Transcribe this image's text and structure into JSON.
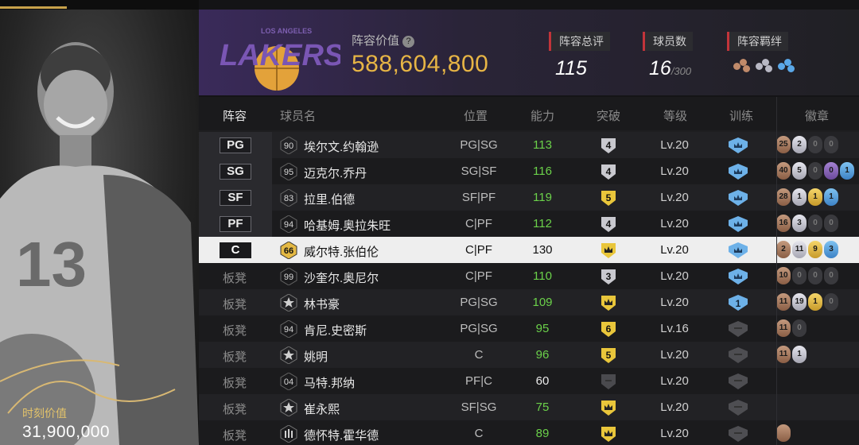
{
  "portrait": {
    "value_label": "时刻价值",
    "value": "31,900,000",
    "jersey_number": "13"
  },
  "header": {
    "team_logo_text": "LAKERS",
    "team_logo_arc": "LOS ANGELES",
    "lineup_value_label": "阵容价值",
    "lineup_value_help": "?",
    "lineup_value": "588,604,800",
    "overall_label": "阵容总评",
    "overall_value": "115",
    "players_label": "球员数",
    "players_value": "16",
    "players_max": "/300",
    "bonds_label": "阵容羁绊"
  },
  "columns": {
    "lineup": "阵容",
    "name": "球员名",
    "position": "位置",
    "ability": "能力",
    "breakthrough": "突破",
    "level": "等级",
    "training": "训练",
    "badges": "徽章"
  },
  "rows": [
    {
      "slot": "PG",
      "jersey": "90",
      "name": "埃尔文.约翰逊",
      "position": "PG|SG",
      "ability": "113",
      "break": "4",
      "level": "Lv.20"
    },
    {
      "slot": "SG",
      "jersey": "95",
      "name": "迈克尔.乔丹",
      "position": "SG|SF",
      "ability": "116",
      "break": "4",
      "level": "Lv.20"
    },
    {
      "slot": "SF",
      "jersey": "83",
      "name": "拉里.伯德",
      "position": "SF|PF",
      "ability": "119",
      "break": "5",
      "level": "Lv.20"
    },
    {
      "slot": "PF",
      "jersey": "94",
      "name": "哈基姆.奥拉朱旺",
      "position": "C|PF",
      "ability": "112",
      "break": "4",
      "level": "Lv.20"
    },
    {
      "slot": "C",
      "jersey": "66",
      "name": "威尔特.张伯伦",
      "position": "C|PF",
      "ability": "130",
      "break": "",
      "level": "Lv.20"
    },
    {
      "slot": "板凳",
      "jersey": "99",
      "name": "沙奎尔.奥尼尔",
      "position": "C|PF",
      "ability": "110",
      "break": "3",
      "level": "Lv.20"
    },
    {
      "slot": "板凳",
      "jersey": "",
      "name": "林书豪",
      "position": "PG|SG",
      "ability": "109",
      "break": "",
      "level": "Lv.20"
    },
    {
      "slot": "板凳",
      "jersey": "94",
      "name": "肯尼.史密斯",
      "position": "PG|SG",
      "ability": "95",
      "break": "6",
      "level": "Lv.16"
    },
    {
      "slot": "板凳",
      "jersey": "",
      "name": "姚明",
      "position": "C",
      "ability": "96",
      "break": "5",
      "level": "Lv.20"
    },
    {
      "slot": "板凳",
      "jersey": "04",
      "name": "马特.邦纳",
      "position": "PF|C",
      "ability": "60",
      "break": "",
      "level": "Lv.20"
    },
    {
      "slot": "板凳",
      "jersey": "",
      "name": "崔永熙",
      "position": "SF|SG",
      "ability": "75",
      "break": "",
      "level": "Lv.20"
    },
    {
      "slot": "板凳",
      "jersey": "",
      "name": "德怀特.霍华德",
      "position": "C",
      "ability": "89",
      "break": "",
      "level": "Lv.20"
    }
  ],
  "badges": [
    [
      "25",
      "2",
      "0",
      "0"
    ],
    [
      "40",
      "5",
      "0",
      "0",
      "1"
    ],
    [
      "28",
      "1",
      "1",
      "1"
    ],
    [
      "16",
      "3",
      "0",
      "0"
    ],
    [
      "2",
      "11",
      "9",
      "3"
    ],
    [
      "10",
      "0",
      "0",
      "0"
    ],
    [
      "11",
      "19",
      "1",
      "0"
    ],
    [
      "11",
      "0"
    ],
    [
      "11",
      "1"
    ],
    [],
    [],
    [
      ""
    ]
  ],
  "colors": {
    "accent_gold": "#e7b545",
    "ability_green": "#6bd14a",
    "header_purple": "#3a2a5a",
    "red_marker": "#c2343a"
  }
}
